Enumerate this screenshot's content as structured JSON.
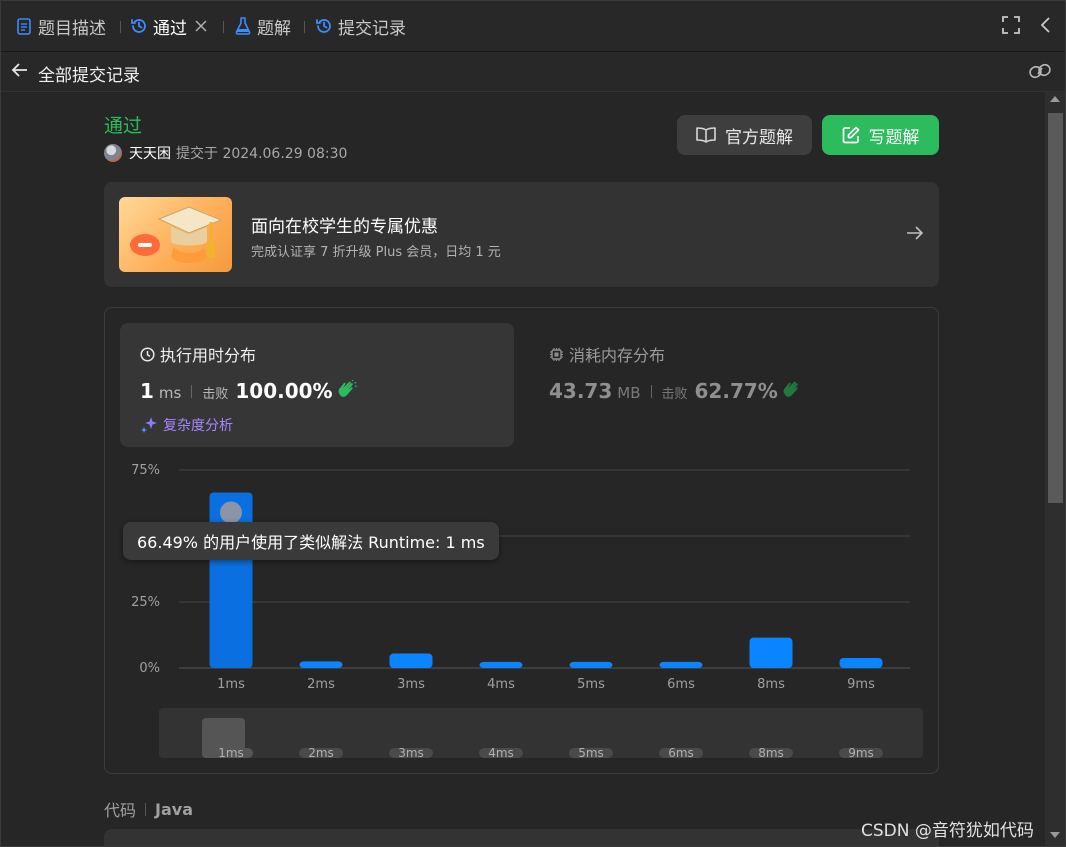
{
  "tabs": [
    {
      "label": "题目描述",
      "icon": "document-icon"
    },
    {
      "label": "通过",
      "icon": "history-icon",
      "active": true,
      "closable": true
    },
    {
      "label": "题解",
      "icon": "flask-icon"
    },
    {
      "label": "提交记录",
      "icon": "history-icon"
    }
  ],
  "header": {
    "back_title": "全部提交记录"
  },
  "submission": {
    "status": "通过",
    "user": "天天困",
    "submitted_at": "提交于 2024.06.29 08:30",
    "official_solution_label": "官方题解",
    "write_solution_label": "写题解"
  },
  "promo": {
    "title": "面向在校学生的专属优惠",
    "subtitle": "完成认证享 7 折升级 Plus 会员，日均 1 元"
  },
  "runtime": {
    "label": "执行用时分布",
    "value": "1",
    "unit": "ms",
    "beat_label": "击败",
    "beat_pct": "100.00%",
    "complexity_label": "复杂度分析"
  },
  "memory": {
    "label": "消耗内存分布",
    "value": "43.73",
    "unit": "MB",
    "beat_label": "击败",
    "beat_pct": "62.77%"
  },
  "chart_data": {
    "type": "bar",
    "categories": [
      "1ms",
      "2ms",
      "3ms",
      "4ms",
      "5ms",
      "6ms",
      "8ms",
      "9ms"
    ],
    "values": [
      66.49,
      2.5,
      5.5,
      2.3,
      2.3,
      2.3,
      11.5,
      3.8
    ],
    "yticks": [
      "0%",
      "25%",
      "",
      "75%"
    ],
    "ytick_values": [
      0,
      25,
      50,
      75
    ],
    "ylim": [
      0,
      75
    ],
    "highlight_index": 0,
    "tooltip": "66.49% 的用户使用了类似解法 Runtime: 1 ms",
    "colors": {
      "bar": "#0a84ff",
      "highlight": "#0a6fe0",
      "grid": "#444444"
    }
  },
  "code": {
    "label": "代码",
    "language": "Java"
  },
  "watermark": "CSDN @音符犹如代码"
}
